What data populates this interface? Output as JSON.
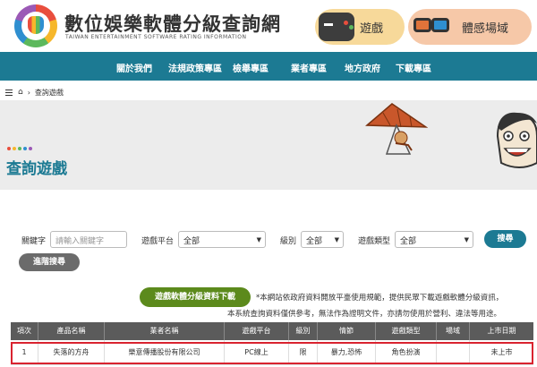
{
  "header": {
    "site_title": "數位娛樂軟體分級查詢網",
    "site_subtitle": "TAIWAN ENTERTAINMENT SOFTWARE RATING INFORMATION",
    "logo_text": "Taiwan Game Software Rating Management",
    "games_label": "遊戲",
    "vr_label": "體感場域"
  },
  "nav": {
    "items": [
      "關於我們",
      "法規政策專區",
      "檢舉專區",
      "業者專區",
      "地方政府",
      "下載專區"
    ]
  },
  "breadcrumb": {
    "current": "查詢遊戲"
  },
  "banner": {
    "title": "查詢遊戲",
    "dot_colors": [
      "#e94e3d",
      "#f6b72b",
      "#5cb85c",
      "#2f8fd0",
      "#9b59b6"
    ]
  },
  "search": {
    "keyword_label": "關鍵字",
    "keyword_placeholder": "請輸入關鍵字",
    "platform_label": "遊戲平台",
    "platform_value": "全部",
    "rating_label": "級別",
    "rating_value": "全部",
    "type_label": "遊戲類型",
    "type_value": "全部",
    "search_button": "搜尋",
    "advanced_button": "進階搜尋"
  },
  "download": {
    "button": "遊戲軟體分級資料下載",
    "notice_line1": "*本網站依政府資料開放平臺使用規範，提供民眾下載遊戲軟體分級資訊，",
    "notice_line2": "本系統查詢資料僅供參考，無法作為證明文件，亦請勿使用於營利、違法等用途。"
  },
  "table": {
    "headers": [
      "項次",
      "產品名稱",
      "業者名稱",
      "遊戲平台",
      "級別",
      "情節",
      "遊戲類型",
      "場域",
      "上市日期"
    ],
    "rows": [
      [
        "1",
        "失落的方舟",
        "樂意傳播股份有限公司",
        "PC線上",
        "限",
        "暴力,恐怖",
        "角色扮演",
        "",
        "未上市"
      ]
    ]
  },
  "colors": {
    "nav": "#1c7a93",
    "title": "#1c7a93",
    "download": "#5c8a1c",
    "highlight": "#d9232f"
  }
}
